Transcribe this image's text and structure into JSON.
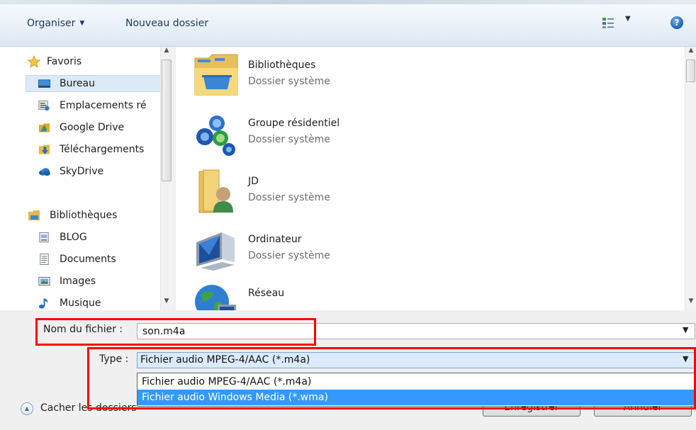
{
  "toolbar": {
    "organize_label": "Organiser",
    "new_folder_label": "Nouveau dossier",
    "help_label": "?"
  },
  "nav": {
    "favorites_header": "Favoris",
    "favorites": [
      {
        "label": "Bureau"
      },
      {
        "label": "Emplacements ré"
      },
      {
        "label": "Google Drive"
      },
      {
        "label": "Téléchargements"
      },
      {
        "label": "SkyDrive"
      }
    ],
    "libraries_header": "Bibliothèques",
    "libraries": [
      {
        "label": "BLOG"
      },
      {
        "label": "Documents"
      },
      {
        "label": "Images"
      },
      {
        "label": "Musique"
      }
    ]
  },
  "content": {
    "items": [
      {
        "name": "Bibliothèques",
        "type": "Dossier système"
      },
      {
        "name": "Groupe résidentiel",
        "type": "Dossier système"
      },
      {
        "name": "JD",
        "type": "Dossier système"
      },
      {
        "name": "Ordinateur",
        "type": "Dossier système"
      },
      {
        "name": "Réseau",
        "type": ""
      }
    ]
  },
  "form": {
    "filename_label": "Nom du fichier :",
    "filename_value": "son.m4a",
    "type_label": "Type :",
    "type_value": "Fichier audio MPEG-4/AAC (*.m4a)",
    "type_options": [
      "Fichier audio MPEG-4/AAC (*.m4a)",
      "Fichier audio Windows Media (*.wma)"
    ],
    "selected_option_index": 1
  },
  "footer": {
    "hide_folders_label": "Cacher les dossiers",
    "save_label": "Enregistrer",
    "cancel_label": "Annuler"
  },
  "colors": {
    "highlight": "#ff0000",
    "selection": "#3399ff"
  }
}
